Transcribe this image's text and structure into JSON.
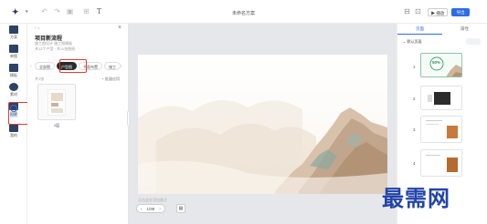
{
  "topbar": {
    "title": "未命名方案",
    "logo": "✦",
    "icons": [
      "undo-icon",
      "redo-icon",
      "save-icon",
      "image-icon",
      "text-icon"
    ],
    "play_label": "▶ 播放",
    "export_label": "导出"
  },
  "rail": {
    "items": [
      {
        "name": "rail-item-1",
        "label": "方案"
      },
      {
        "name": "rail-item-2",
        "label": "单图"
      },
      {
        "name": "rail-item-3",
        "label": "模板"
      },
      {
        "name": "rail-item-4",
        "label": "素材"
      },
      {
        "name": "rail-item-5",
        "label": "拍摄"
      },
      {
        "name": "rail-item-floorplan",
        "label": "图纸"
      },
      {
        "name": "rail-item-7",
        "label": "我的"
      }
    ]
  },
  "panel": {
    "nav": "‹ ⌂",
    "title": "项目新流程",
    "subtitle": "施工图设计 施工图模板",
    "count": "共12个户型 · 共11张图纸",
    "tabs": [
      "全部图",
      "户型图",
      "平面布置",
      "施工"
    ],
    "total": "共1张",
    "select_all": "+ 批量应用",
    "thumb_caption": "1层"
  },
  "canvas": {
    "below_text": "点击此处添加备注",
    "pager_prev": "‹",
    "pager_label": "1/98",
    "pager_next": "›",
    "tool_icon": "▤"
  },
  "rpanel": {
    "tab_pages": "页面",
    "tab_props": "属性",
    "section": "默认页面",
    "slides": [
      {
        "num": "1"
      },
      {
        "num": "2"
      },
      {
        "num": "3"
      },
      {
        "num": "4"
      }
    ],
    "badge": "50%"
  },
  "watermark": "最需网",
  "colors": {
    "accent": "#2b6de6",
    "highlight": "#e2382c",
    "rail_icon": "#2c4266",
    "active_tab": "#2a2a2a"
  }
}
